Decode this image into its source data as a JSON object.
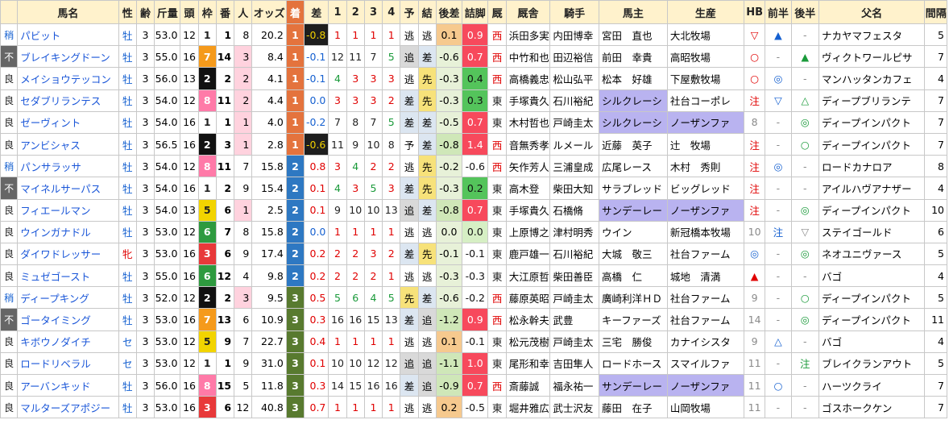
{
  "headers": [
    "",
    "馬名",
    "性",
    "齢",
    "斤量",
    "頭",
    "枠",
    "番",
    "人",
    "オッズ",
    "着",
    "差",
    "1",
    "2",
    "3",
    "4",
    "予",
    "結",
    "後差",
    "詰脚",
    "厩",
    "厩舎",
    "騎手",
    "馬主",
    "生産",
    "HB",
    "前半",
    "後半",
    "父名",
    "間隔"
  ],
  "rows": [
    [
      "稍",
      "パビット",
      "牡",
      "3",
      "53.0",
      "12",
      "1",
      "1",
      "8",
      "20.2",
      "1",
      "-0.8",
      "1",
      "1",
      "1",
      "1",
      "逃",
      "逃",
      "0.1",
      "0.9",
      "西",
      "浜田多実",
      "内田博幸",
      "宮田　直也",
      "大北牧場",
      "▽",
      "▲",
      "-",
      "ナカヤマフェスタ",
      "5"
    ],
    [
      "不",
      "ブレイキングドーン",
      "牡",
      "3",
      "55.0",
      "16",
      "7",
      "14",
      "3",
      "8.4",
      "1",
      "-0.1",
      "12",
      "11",
      "7",
      "5",
      "追",
      "差",
      "-0.6",
      "0.7",
      "西",
      "中竹和也",
      "田辺裕信",
      "前田　幸貴",
      "高昭牧場",
      "○",
      "-",
      "▲",
      "ヴィクトワールピサ",
      "7"
    ],
    [
      "良",
      "メイショウテッコン",
      "牡",
      "3",
      "56.0",
      "13",
      "2",
      "2",
      "2",
      "4.1",
      "1",
      "-0.1",
      "4",
      "3",
      "3",
      "3",
      "逃",
      "先",
      "-0.3",
      "0.4",
      "西",
      "高橋義忠",
      "松山弘平",
      "松本　好雄",
      "下屋敷牧場",
      "○",
      "◎",
      "-",
      "マンハッタンカフェ",
      "4"
    ],
    [
      "良",
      "セダブリランテス",
      "牡",
      "3",
      "54.0",
      "12",
      "8",
      "11",
      "2",
      "4.4",
      "1",
      "0.0",
      "3",
      "3",
      "3",
      "2",
      "差",
      "先",
      "-0.3",
      "0.3",
      "東",
      "手塚貴久",
      "石川裕紀",
      "シルクレーシ",
      "社台コーポレ",
      "注",
      "▽",
      "△",
      "ディープブリランテ",
      "7"
    ],
    [
      "良",
      "ゼーヴィント",
      "牡",
      "3",
      "54.0",
      "16",
      "1",
      "1",
      "1",
      "4.0",
      "1",
      "-0.2",
      "7",
      "8",
      "7",
      "5",
      "差",
      "差",
      "-0.5",
      "0.7",
      "東",
      "木村哲也",
      "戸崎圭太",
      "シルクレーシ",
      "ノーザンファ",
      "8",
      "-",
      "◎",
      "ディープインパクト",
      "7"
    ],
    [
      "良",
      "アンビシャス",
      "牡",
      "3",
      "56.5",
      "16",
      "2",
      "3",
      "1",
      "2.8",
      "1",
      "-0.6",
      "11",
      "9",
      "10",
      "8",
      "予",
      "差",
      "-0.8",
      "1.4",
      "西",
      "音無秀孝",
      "ルメール",
      "近藤　英子",
      "辻　牧場",
      "注",
      "-",
      "○",
      "ディープインパクト",
      "7"
    ],
    [
      "稍",
      "パンサラッサ",
      "牡",
      "3",
      "54.0",
      "12",
      "8",
      "11",
      "7",
      "15.8",
      "2",
      "0.8",
      "3",
      "4",
      "2",
      "2",
      "逃",
      "先",
      "-0.2",
      "-0.6",
      "西",
      "矢作芳人",
      "三浦皇成",
      "広尾レース",
      "木村　秀則",
      "注",
      "◎",
      "-",
      "ロードカナロア",
      "8"
    ],
    [
      "不",
      "マイネルサーパス",
      "牡",
      "3",
      "54.0",
      "16",
      "1",
      "2",
      "9",
      "15.4",
      "2",
      "0.1",
      "4",
      "3",
      "5",
      "3",
      "差",
      "先",
      "-0.3",
      "0.2",
      "東",
      "高木登",
      "柴田大知",
      "サラブレッド",
      "ビッグレッド",
      "注",
      "-",
      "-",
      "アイルハヴアナザー",
      "4"
    ],
    [
      "良",
      "フィエールマン",
      "牡",
      "3",
      "54.0",
      "13",
      "5",
      "6",
      "1",
      "2.5",
      "2",
      "0.1",
      "9",
      "10",
      "10",
      "13",
      "追",
      "差",
      "-0.8",
      "0.7",
      "東",
      "手塚貴久",
      "石橋脩",
      "サンデーレー",
      "ノーザンファ",
      "注",
      "-",
      "◎",
      "ディープインパクト",
      "10"
    ],
    [
      "良",
      "ウインガナドル",
      "牡",
      "3",
      "53.0",
      "12",
      "6",
      "7",
      "8",
      "15.8",
      "2",
      "0.0",
      "1",
      "1",
      "1",
      "1",
      "逃",
      "逃",
      "0.0",
      "0.0",
      "東",
      "上原博之",
      "津村明秀",
      "ウイン",
      "新冠橋本牧場",
      "10",
      "注",
      "▽",
      "ステイゴールド",
      "6"
    ],
    [
      "良",
      "ダイワドレッサー",
      "牝",
      "3",
      "53.0",
      "16",
      "3",
      "6",
      "9",
      "17.4",
      "2",
      "0.2",
      "2",
      "2",
      "3",
      "2",
      "差",
      "先",
      "-0.1",
      "-0.1",
      "東",
      "鹿戸雄一",
      "石川裕紀",
      "大城　敬三",
      "社台ファーム",
      "◎",
      "-",
      "◎",
      "ネオユニヴァース",
      "5"
    ],
    [
      "良",
      "ミュゼゴースト",
      "牡",
      "3",
      "55.0",
      "16",
      "6",
      "12",
      "4",
      "9.8",
      "2",
      "0.2",
      "2",
      "2",
      "2",
      "1",
      "逃",
      "逃",
      "-0.3",
      "-0.3",
      "東",
      "大江原哲",
      "柴田善臣",
      "高橋　仁",
      "城地　清満",
      "▲",
      "-",
      "-",
      "バゴ",
      "4"
    ],
    [
      "稍",
      "ディープキング",
      "牡",
      "3",
      "52.0",
      "12",
      "2",
      "2",
      "3",
      "9.5",
      "3",
      "0.5",
      "5",
      "6",
      "4",
      "5",
      "先",
      "差",
      "-0.6",
      "-0.2",
      "西",
      "藤原英昭",
      "戸崎圭太",
      "廣崎利洋ＨＤ",
      "社台ファーム",
      "9",
      "-",
      "○",
      "ディープインパクト",
      "5"
    ],
    [
      "不",
      "ゴータイミング",
      "牡",
      "3",
      "53.0",
      "16",
      "7",
      "13",
      "6",
      "10.9",
      "3",
      "0.3",
      "16",
      "16",
      "15",
      "13",
      "差",
      "追",
      "-1.2",
      "0.9",
      "西",
      "松永幹夫",
      "武豊",
      "キーファーズ",
      "社台ファーム",
      "14",
      "-",
      "◎",
      "ディープインパクト",
      "11"
    ],
    [
      "良",
      "キボウノダイチ",
      "セ",
      "3",
      "53.0",
      "12",
      "5",
      "9",
      "7",
      "22.7",
      "3",
      "0.4",
      "1",
      "1",
      "1",
      "1",
      "逃",
      "逃",
      "0.1",
      "-0.1",
      "東",
      "松元茂樹",
      "戸崎圭太",
      "三宅　勝俊",
      "カナイシスタ",
      "9",
      "△",
      "-",
      "バゴ",
      "4"
    ],
    [
      "良",
      "ロードリベラル",
      "セ",
      "3",
      "53.0",
      "12",
      "1",
      "1",
      "9",
      "31.0",
      "3",
      "0.1",
      "10",
      "10",
      "12",
      "12",
      "追",
      "追",
      "-1.1",
      "1.0",
      "東",
      "尾形和幸",
      "吉田隼人",
      "ロードホース",
      "スマイルファ",
      "11",
      "-",
      "注",
      "ブレイクランアウト",
      "5"
    ],
    [
      "良",
      "アーバンキッド",
      "牡",
      "3",
      "56.0",
      "16",
      "8",
      "15",
      "5",
      "11.8",
      "3",
      "0.3",
      "14",
      "15",
      "16",
      "16",
      "差",
      "追",
      "-0.9",
      "0.7",
      "西",
      "斎藤誠",
      "福永祐一",
      "サンデーレー",
      "ノーザンファ",
      "11",
      "○",
      "-",
      "ハーツクライ",
      "7"
    ],
    [
      "良",
      "マルターズアポジー",
      "牡",
      "3",
      "53.0",
      "16",
      "3",
      "6",
      "12",
      "40.8",
      "3",
      "0.7",
      "1",
      "1",
      "1",
      "1",
      "逃",
      "逃",
      "0.2",
      "-0.5",
      "東",
      "堀井雅広",
      "武士沢友",
      "藤田　在子",
      "山岡牧場",
      "11",
      "-",
      "-",
      "ゴスホークケン",
      "7"
    ]
  ],
  "colors": {
    "header_bg": "#fff2cc",
    "name_text": "#1a56d8",
    "chaku_orange": "#e4733d",
    "chaku_blue": "#2e78c2",
    "chaku_green": "#587a2f",
    "waku_1": "#ffffff",
    "waku_2": "#111111",
    "waku_3": "#e8393a",
    "waku_4": "#2e78c2",
    "waku_5": "#f2d400",
    "waku_6": "#2e9a3f",
    "waku_7": "#f59a1b",
    "waku_8": "#ff7aa8",
    "owner_purple": "#b9b3f0",
    "pink": "#ffd2de"
  }
}
